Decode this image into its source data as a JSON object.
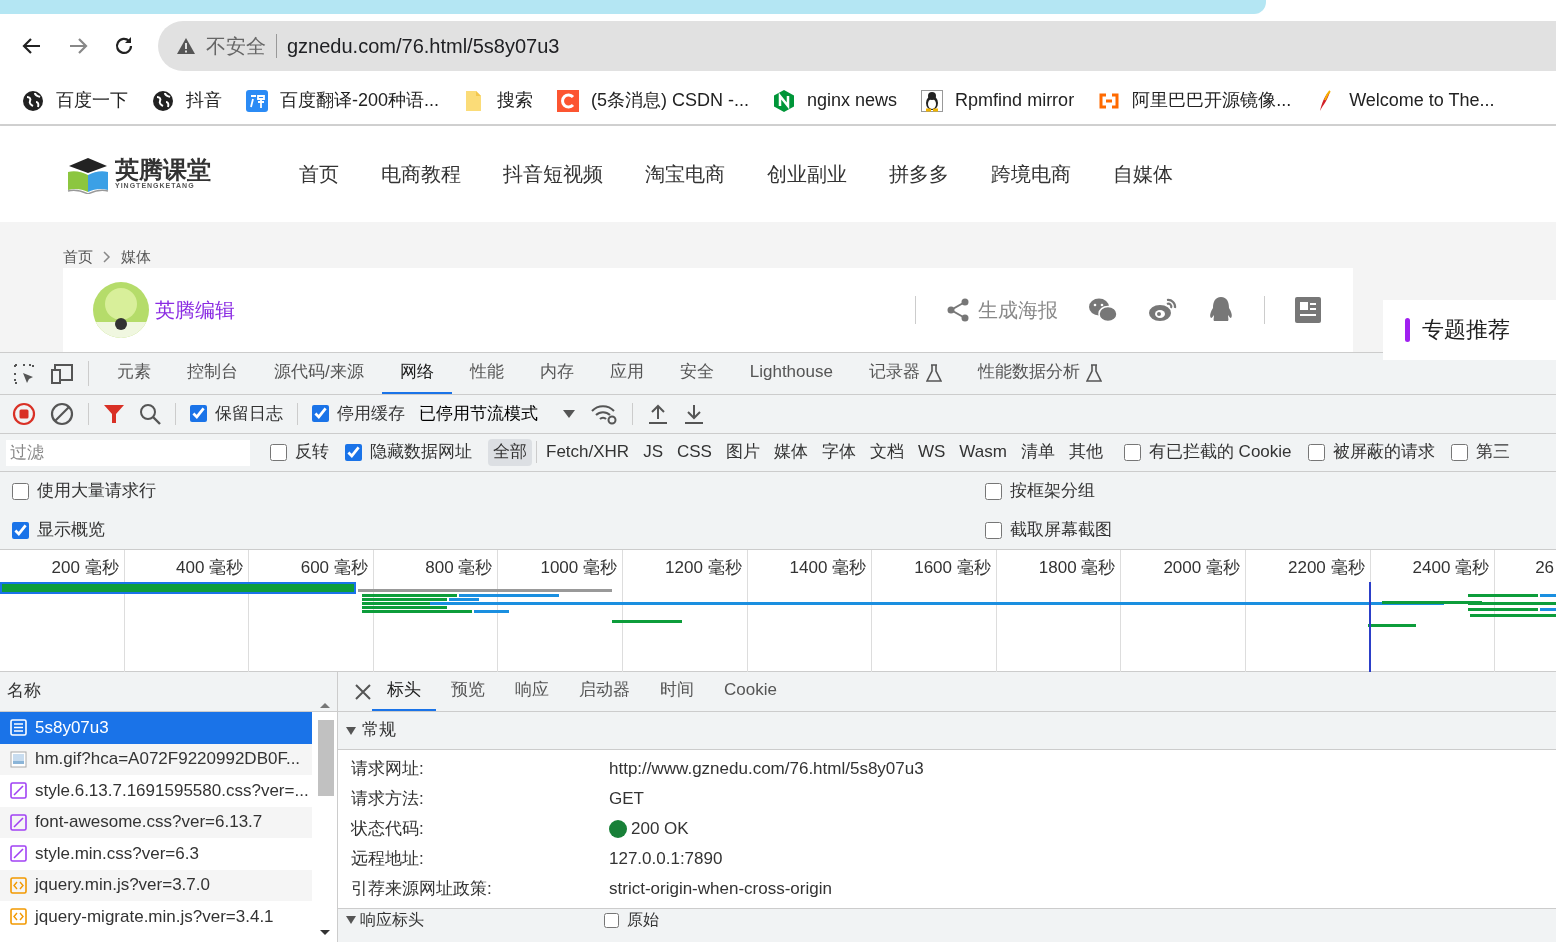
{
  "browser": {
    "security_label": "不安全",
    "url": "gznedu.com/76.html/5s8y07u3"
  },
  "bookmarks": [
    {
      "label": "百度一下",
      "kind": "globe"
    },
    {
      "label": "抖音",
      "kind": "globe"
    },
    {
      "label": "百度翻译-200种语...",
      "kind": "translate"
    },
    {
      "label": "搜索",
      "kind": "folder"
    },
    {
      "label": "(5条消息) CSDN -...",
      "kind": "csdn"
    },
    {
      "label": "nginx news",
      "kind": "nginx"
    },
    {
      "label": "Rpmfind mirror",
      "kind": "penguin"
    },
    {
      "label": "阿里巴巴开源镜像...",
      "kind": "aliyun"
    },
    {
      "label": "Welcome to The...",
      "kind": "feather"
    }
  ],
  "site": {
    "logo_text": "英腾课堂",
    "logo_subtext": "YINGTENGKETANG",
    "nav": [
      "首页",
      "电商教程",
      "抖音短视频",
      "淘宝电商",
      "创业副业",
      "拼多多",
      "跨境电商",
      "自媒体"
    ],
    "breadcrumb": [
      "首页",
      "媒体"
    ],
    "author": "英腾编辑",
    "share_label": "生成海报",
    "sidebar_title": "专题推荐"
  },
  "devtools": {
    "tabs": [
      {
        "label": "元素",
        "selected": false,
        "experimental": false
      },
      {
        "label": "控制台",
        "selected": false,
        "experimental": false
      },
      {
        "label": "源代码/来源",
        "selected": false,
        "experimental": false
      },
      {
        "label": "网络",
        "selected": true,
        "experimental": false
      },
      {
        "label": "性能",
        "selected": false,
        "experimental": false
      },
      {
        "label": "内存",
        "selected": false,
        "experimental": false
      },
      {
        "label": "应用",
        "selected": false,
        "experimental": false
      },
      {
        "label": "安全",
        "selected": false,
        "experimental": false
      },
      {
        "label": "Lighthouse",
        "selected": false,
        "experimental": false
      },
      {
        "label": "记录器",
        "selected": false,
        "experimental": true
      },
      {
        "label": "性能数据分析",
        "selected": false,
        "experimental": true
      }
    ],
    "toolbar": {
      "recording": true,
      "filter_active": true,
      "checkboxes": [
        {
          "label": "保留日志",
          "checked": true
        },
        {
          "label": "停用缓存",
          "checked": true
        }
      ],
      "throttling": "已停用节流模式"
    },
    "filter": {
      "placeholder": "过滤",
      "before": [
        {
          "label": "反转",
          "checked": false
        },
        {
          "label": "隐藏数据网址",
          "checked": true
        }
      ],
      "types": [
        {
          "label": "全部",
          "selected": true
        },
        {
          "label": "Fetch/XHR",
          "selected": false
        },
        {
          "label": "JS",
          "selected": false
        },
        {
          "label": "CSS",
          "selected": false
        },
        {
          "label": "图片",
          "selected": false
        },
        {
          "label": "媒体",
          "selected": false
        },
        {
          "label": "字体",
          "selected": false
        },
        {
          "label": "文档",
          "selected": false
        },
        {
          "label": "WS",
          "selected": false
        },
        {
          "label": "Wasm",
          "selected": false
        },
        {
          "label": "清单",
          "selected": false
        },
        {
          "label": "其他",
          "selected": false
        }
      ],
      "after": [
        {
          "label": "有已拦截的 Cookie",
          "checked": false
        },
        {
          "label": "被屏蔽的请求",
          "checked": false
        },
        {
          "label": "第三",
          "checked": false
        }
      ]
    },
    "options": [
      {
        "label": "使用大量请求行",
        "checked": false
      },
      {
        "label": "按框架分组",
        "checked": false
      },
      {
        "label": "显示概览",
        "checked": true
      },
      {
        "label": "截取屏幕截图",
        "checked": false
      }
    ],
    "timeline": {
      "ticks": [
        "200 毫秒",
        "400 毫秒",
        "600 毫秒",
        "800 毫秒",
        "1000 毫秒",
        "1200 毫秒",
        "1400 毫秒",
        "1600 毫秒",
        "1800 毫秒",
        "2000 毫秒",
        "2200 毫秒",
        "2400 毫秒",
        "26"
      ]
    },
    "requests": {
      "column": "名称",
      "rows": [
        {
          "name": "5s8y07u3",
          "kind": "document",
          "selected": true
        },
        {
          "name": "hm.gif?hca=A072F9220992DB0F...",
          "kind": "image",
          "selected": false
        },
        {
          "name": "style.6.13.7.1691595580.css?ver=...",
          "kind": "stylesheet",
          "selected": false
        },
        {
          "name": "font-awesome.css?ver=6.13.7",
          "kind": "stylesheet",
          "selected": false
        },
        {
          "name": "style.min.css?ver=6.3",
          "kind": "stylesheet",
          "selected": false
        },
        {
          "name": "jquery.min.js?ver=3.7.0",
          "kind": "script",
          "selected": false
        },
        {
          "name": "jquery-migrate.min.js?ver=3.4.1",
          "kind": "script",
          "selected": false
        }
      ]
    },
    "details": {
      "tabs": [
        {
          "label": "标头",
          "selected": true
        },
        {
          "label": "预览",
          "selected": false
        },
        {
          "label": "响应",
          "selected": false
        },
        {
          "label": "启动器",
          "selected": false
        },
        {
          "label": "时间",
          "selected": false
        },
        {
          "label": "Cookie",
          "selected": false
        }
      ],
      "general": {
        "title": "常规",
        "fields": [
          {
            "label": "请求网址:",
            "value": "http://www.gznedu.com/76.html/5s8y07u3"
          },
          {
            "label": "请求方法:",
            "value": "GET"
          },
          {
            "label": "状态代码:",
            "value": "200 OK",
            "color": "#188038"
          },
          {
            "label": "远程地址:",
            "value": "127.0.0.1:7890"
          },
          {
            "label": "引荐来源网址政策:",
            "value": "strict-origin-when-cross-origin"
          }
        ]
      },
      "response_headers": {
        "title": "响应标头",
        "raw": {
          "label": "原始",
          "checked": false
        }
      }
    }
  }
}
